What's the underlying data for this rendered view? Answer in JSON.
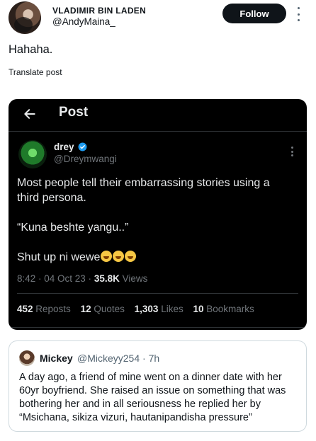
{
  "post": {
    "author_name": "VLADIMIR BIN LADEN",
    "author_handle": "@AndyMaina_",
    "follow_label": "Follow",
    "text": "Hahaha.",
    "translate_label": "Translate post"
  },
  "embedded_post": {
    "title": "Post",
    "author_name": "drey",
    "author_handle": "@Dreymwangi",
    "paragraphs": [
      "Most people tell their embarrassing stories using a third persona.",
      "“Kuna beshte yangu..”",
      "Shut up  ni wewe"
    ],
    "time": "8:42 · 04 Oct 23 · ",
    "views_count": "35.8K",
    "views_label": " Views",
    "stats": [
      {
        "count": "452",
        "label": " Reposts"
      },
      {
        "count": "12",
        "label": " Quotes"
      },
      {
        "count": "1,303",
        "label": " Likes"
      },
      {
        "count": "10",
        "label": " Bookmarks"
      }
    ]
  },
  "quoted_post": {
    "author_name": "Mickey",
    "handle_time": "@Mickeyy254 · 7h",
    "text": "A day ago, a friend of mine went on a dinner date with her 60yr boyfriend. She raised an issue on something that was bothering her and in all seriousness he replied her by “Msichana, sikiza vizuri, hautanipandisha pressure”"
  },
  "icons": {
    "more": "more-vertical-icon",
    "back": "arrow-left-icon",
    "verified": "verified-badge-icon",
    "emoji": "face-with-tears-of-joy-emoji"
  },
  "colors": {
    "accent": "#1d9bf0",
    "text": "#0f1419",
    "secondary": "#536471",
    "dark_bg": "#000000"
  }
}
